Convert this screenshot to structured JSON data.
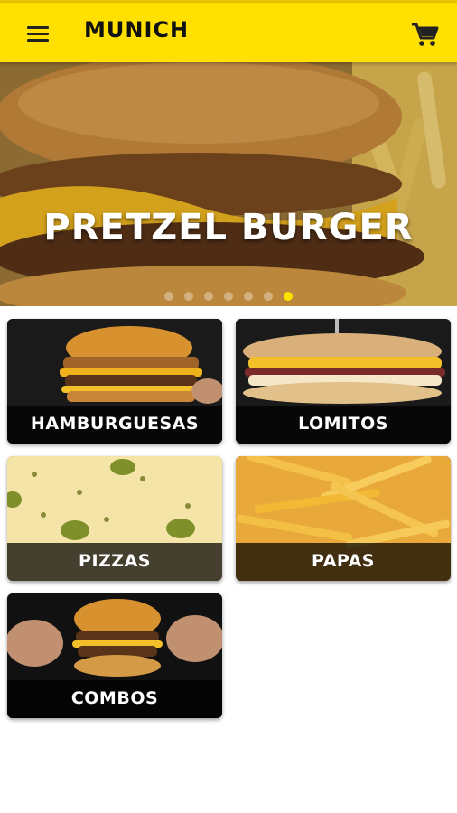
{
  "app": {
    "title": "MUNICH"
  },
  "icons": {
    "menu": "menu-icon",
    "cart": "shopping-cart-icon"
  },
  "colors": {
    "brand_yellow": "#ffe000",
    "label_text": "#ffffff"
  },
  "hero": {
    "title": "PRETZEL BURGER",
    "slide_count": 7,
    "active_slide": 7
  },
  "categories": [
    {
      "label": "HAMBURGUESAS"
    },
    {
      "label": "LOMITOS"
    },
    {
      "label": "PIZZAS"
    },
    {
      "label": "PAPAS"
    },
    {
      "label": "COMBOS"
    }
  ]
}
